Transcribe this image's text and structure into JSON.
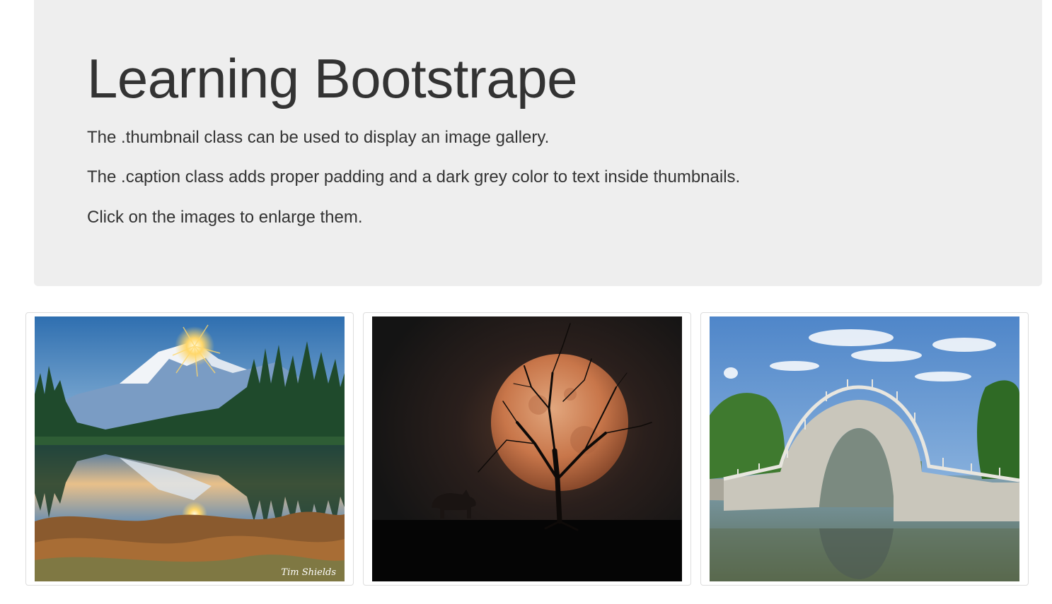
{
  "header": {
    "title": "Learning Bootstrape",
    "lines": [
      "The .thumbnail class can be used to display an image gallery.",
      "The .caption class adds proper padding and a dark grey color to text inside thumbnails.",
      "Click on the images to enlarge them."
    ]
  },
  "gallery": {
    "items": [
      {
        "subject": "mountain-lake-sunrise",
        "watermark": "Tim Shields"
      },
      {
        "subject": "full-moon-tree-rhino-silhouette"
      },
      {
        "subject": "stone-arch-bridge-over-lake"
      }
    ]
  },
  "colors": {
    "jumbotron_bg": "#eeeeee",
    "text": "#333333",
    "thumbnail_border": "#dddddd"
  }
}
